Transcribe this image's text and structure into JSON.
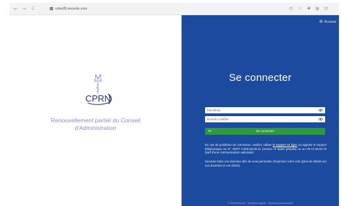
{
  "browser": {
    "url": "votecf8.neovote.com",
    "back_icon": "←",
    "forward_icon": "→",
    "reload_icon": "C",
    "ext_icons": [
      "⊡",
      "☆",
      "✱",
      "▤",
      "⊡"
    ]
  },
  "left_panel": {
    "logo_text": "CPRN",
    "tagline_line1": "Renouvellement partiel du Conseil",
    "tagline_line2": "d'Administration"
  },
  "right_panel": {
    "accessibility_label": "Accessi",
    "title": "Se connecter",
    "identifier_placeholder": "Identifiant",
    "affiliate_placeholder": "Numéro d'affilié",
    "login_button": "Se connecter",
    "info_text_1a": "En cas de problème de connexion, veuillez utiliser ",
    "info_link": "le support en ligne",
    "info_text_1b": " ou appeler le support téléphonique au N° VERT 0.805.69.06.41 (service et appel gratuits) ou au 09.72.36.50.70 (tarif d'une communication nationale).",
    "info_text_2": "Neovote traite vos données afin de vous permettre d'exprimer votre vote (plus de détails sur vos données et vos droits).",
    "footer": "© 2025 Neovote · Mentions légales · Données personnelles"
  },
  "colors": {
    "brand_blue": "#1b4a9e",
    "button_green": "#2d9b3c",
    "logo_navy": "#2b3175"
  }
}
